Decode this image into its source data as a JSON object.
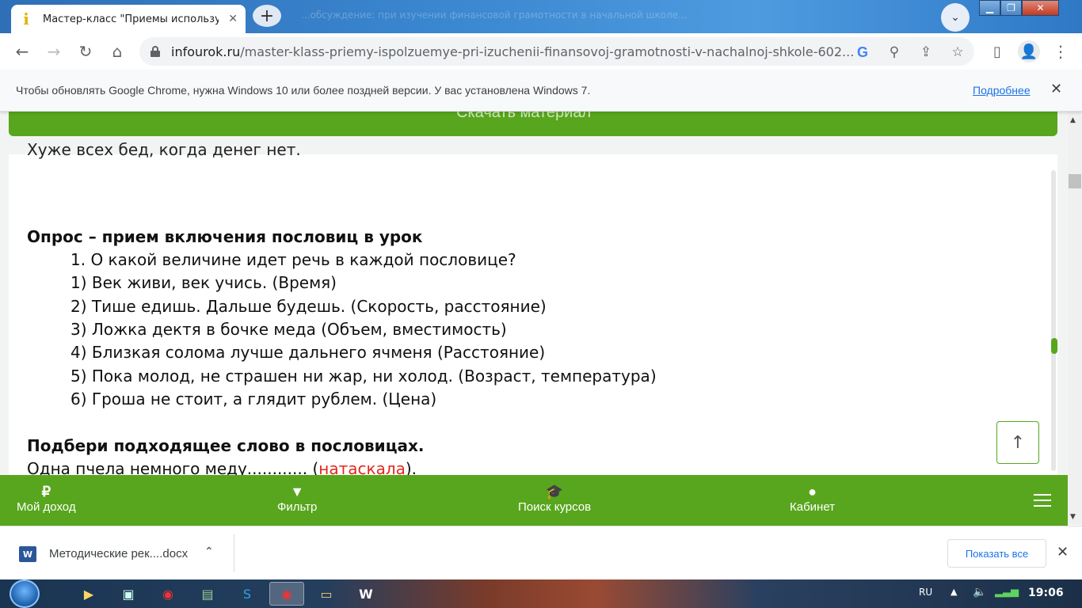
{
  "browser": {
    "tab_title": "Мастер-класс \"Приемы используе",
    "tab_close": "✕",
    "new_tab": "+",
    "background_blur": "...обсуждение: при изучении финансовой грамотности в начальной школе...",
    "url_domain": "infourok.ru",
    "url_path": "/master-klass-priemy-ispolzuemye-pri-izuchenii-finansovoj-gramotnosti-v-nachalnoj-shkole-602..."
  },
  "infobar": {
    "message": "Чтобы обновлять Google Chrome, нужна Windows 10 или более поздней версии. У вас установлена Windows 7.",
    "link": "Подробнее",
    "close": "✕"
  },
  "page": {
    "download_button": "Скачать материал",
    "cut_line": "Хуже всех бед,                    когда денег нет.",
    "section1_title": "Опрос – прием включения пословиц в урок",
    "question": "1.   О какой величине идет речь в каждой пословице?",
    "items": [
      "1)  Век живи, век учись. (Время)",
      "2)  Тише едишь. Дальше будешь. (Скорость, расстояние)",
      "3)  Ложка дектя в бочке меда (Объем, вместимость)",
      "4)  Близкая солома лучше дальнего ячменя (Расстояние)",
      "5)  Пока молод, не страшен ни жар, ни холод. (Возраст, температура)",
      "6)  Гроша не стоит, а глядит рублем. (Цена)"
    ],
    "section2_title": "Подбери подходящее слово в пословицах.",
    "line_prefix": "Одна пчела немного меду............ (",
    "line_answer": "натаскала",
    "line_suffix": ").",
    "scroll_top": "↑"
  },
  "bottom_nav": {
    "income": "Мой доход",
    "filter": "Фильтр",
    "courses": "Поиск курсов",
    "cabinet": "Кабинет"
  },
  "shelf": {
    "file_name": "Методические рек....docx",
    "show_all": "Показать все",
    "close": "✕"
  },
  "taskbar": {
    "lang": "RU",
    "time": "19:06"
  },
  "colors": {
    "accent_green": "#58a61d",
    "answer_red": "#e0281f",
    "link_blue": "#1a73e8"
  }
}
